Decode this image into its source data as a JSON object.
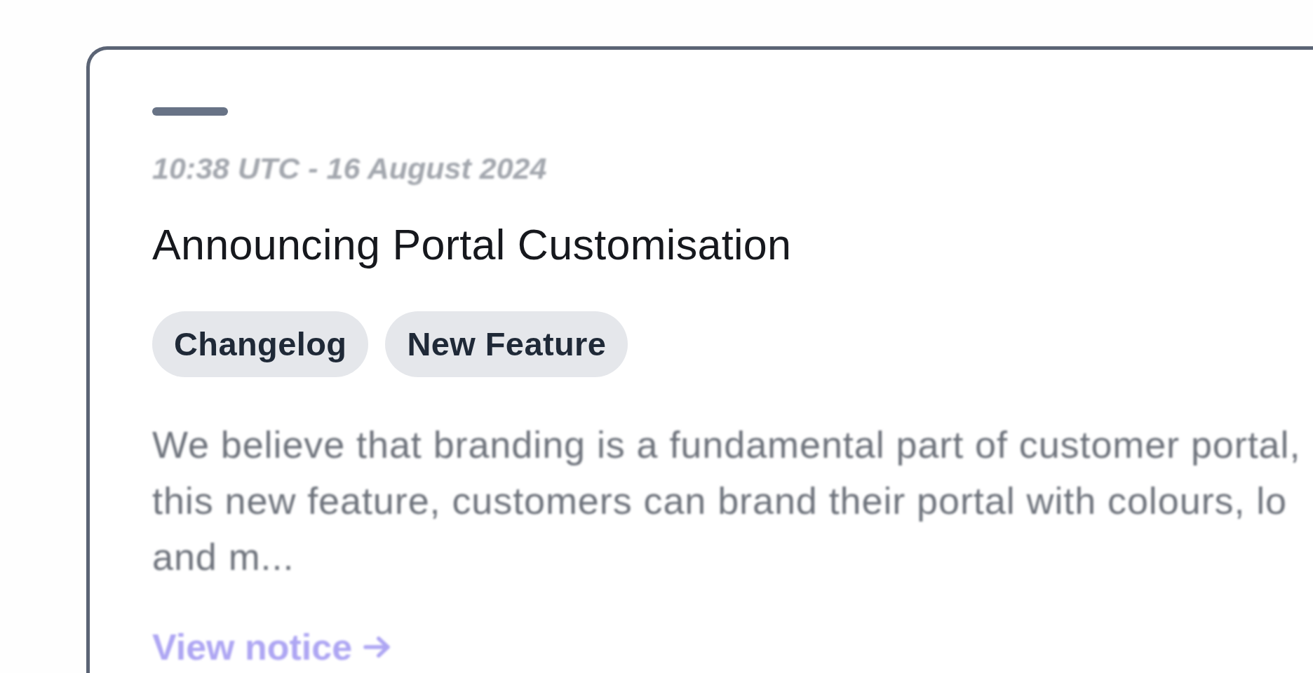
{
  "card": {
    "timestamp": "10:38 UTC - 16 August 2024",
    "title": "Announcing Portal Customisation",
    "tags": [
      {
        "label": "Changelog"
      },
      {
        "label": "New Feature"
      }
    ],
    "excerpt_lines": [
      "We believe that branding is a fundamental part of customer portal,",
      "this new feature, customers can brand their portal with colours, lo",
      "and m..."
    ],
    "link": {
      "label": "View notice"
    }
  }
}
